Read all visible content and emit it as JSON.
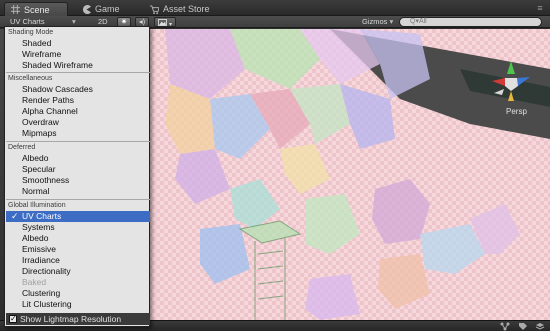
{
  "tabs": [
    {
      "label": "Scene",
      "icon": "grid-icon",
      "active": true
    },
    {
      "label": "Game",
      "icon": "pacman-icon",
      "active": false
    },
    {
      "label": "Asset Store",
      "icon": "cart-icon",
      "active": false
    }
  ],
  "toolbar": {
    "draw_mode": "UV Charts",
    "two_d": "2D",
    "gizmos": "Gizmos",
    "search_placeholder": "Q▾All"
  },
  "viewport": {
    "projection": "Persp"
  },
  "menu": {
    "sections": [
      {
        "header": "Shading Mode",
        "items": [
          "Shaded",
          "Wireframe",
          "Shaded Wireframe"
        ]
      },
      {
        "header": "Miscellaneous",
        "items": [
          "Shadow Cascades",
          "Render Paths",
          "Alpha Channel",
          "Overdraw",
          "Mipmaps"
        ]
      },
      {
        "header": "Deferred",
        "items": [
          "Albedo",
          "Specular",
          "Smoothness",
          "Normal"
        ]
      },
      {
        "header": "Global Illumination",
        "items": [
          "UV Charts",
          "Systems",
          "Albedo",
          "Emissive",
          "Irradiance",
          "Directionality",
          "Baked",
          "Clustering",
          "Lit Clustering"
        ]
      }
    ],
    "selected": "UV Charts",
    "disabled": "Baked",
    "footer": "Show Lightmap Resolution",
    "check_mark": "✓"
  }
}
